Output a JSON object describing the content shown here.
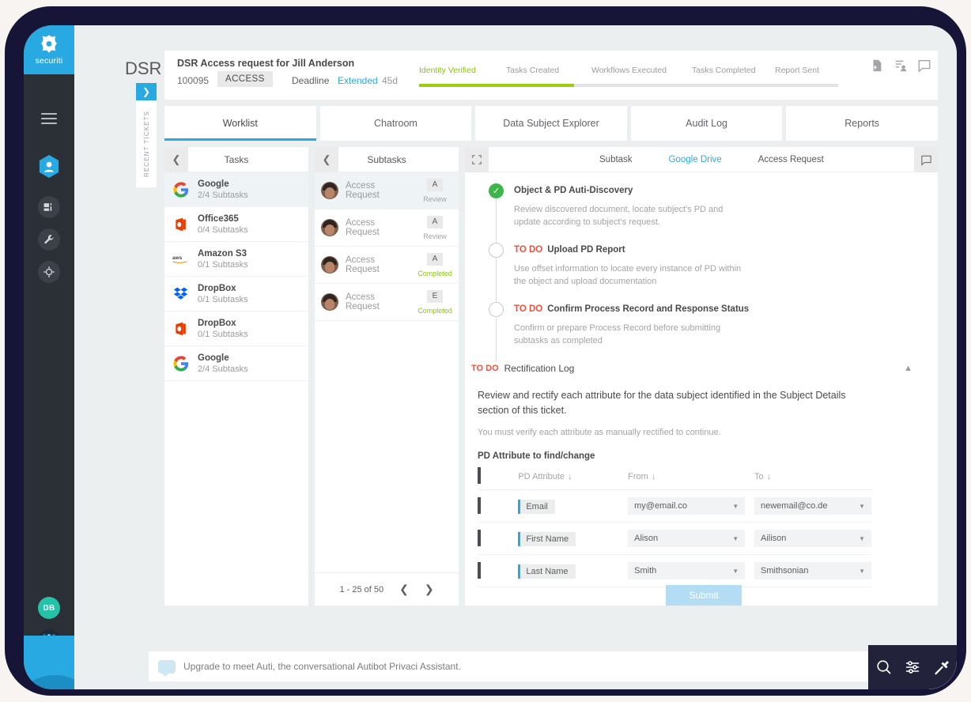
{
  "brand": {
    "name": "securiti",
    "accent": "#29a9e1",
    "logo_icon": "securiti-logo-icon"
  },
  "page": {
    "title": "DSR Workbench"
  },
  "recent_tickets": {
    "label": "RECENT TICKETS",
    "expand_icon": "chevron-right-icon"
  },
  "ticket": {
    "title": "DSR Access request for Jill Anderson",
    "id": "100095",
    "type_badge": "ACCESS",
    "deadline_label": "Deadline",
    "deadline_value": "Extended",
    "deadline_days": "45d",
    "icons": [
      "document-add-icon",
      "assign-user-icon",
      "chat-bubble-icon"
    ]
  },
  "progress": {
    "done_color": "#8cc410",
    "steps": [
      {
        "label": "Identity Verified",
        "done": true
      },
      {
        "label": "Tasks Created",
        "done": false
      },
      {
        "label": "Workflows Executed",
        "done": false
      },
      {
        "label": "Tasks Completed",
        "done": false
      },
      {
        "label": "Report Sent",
        "done": false
      }
    ]
  },
  "tabs": [
    {
      "label": "Worklist",
      "active": true
    },
    {
      "label": "Chatroom",
      "active": false
    },
    {
      "label": "Data Subject Explorer",
      "active": false
    },
    {
      "label": "Audit Log",
      "active": false
    },
    {
      "label": "Reports",
      "active": false
    }
  ],
  "tasks_panel": {
    "header": "Tasks",
    "back_icon": "chevron-left-icon",
    "items": [
      {
        "name": "Google",
        "subtasks": "2/4 Subtasks",
        "logo": "google-logo-icon",
        "selected": true
      },
      {
        "name": "Office365",
        "subtasks": "0/4 Subtasks",
        "logo": "office365-logo-icon",
        "selected": false
      },
      {
        "name": "Amazon S3",
        "subtasks": "0/1 Subtasks",
        "logo": "aws-logo-icon",
        "selected": false
      },
      {
        "name": "DropBox",
        "subtasks": "0/1 Subtasks",
        "logo": "dropbox-logo-icon",
        "selected": false
      },
      {
        "name": "DropBox",
        "subtasks": "0/1 Subtasks",
        "logo": "office365-logo-icon",
        "selected": false
      },
      {
        "name": "Google",
        "subtasks": "2/4 Subtasks",
        "logo": "google-logo-icon",
        "selected": false
      }
    ]
  },
  "subtasks_panel": {
    "header": "Subtasks",
    "back_icon": "chevron-left-icon",
    "items": [
      {
        "name": "Access Request",
        "key": "A",
        "status": "Review",
        "completed": false,
        "selected": true
      },
      {
        "name": "Access Request",
        "key": "A",
        "status": "Review",
        "completed": false,
        "selected": false
      },
      {
        "name": "Access Request",
        "key": "A",
        "status": "Completed",
        "completed": true,
        "selected": false
      },
      {
        "name": "Access Request",
        "key": "E",
        "status": "Completed",
        "completed": true,
        "selected": false
      }
    ],
    "pagination": {
      "range": "1 - 25 of 50",
      "prev_icon": "chevron-left-icon",
      "next_icon": "chevron-right-icon"
    }
  },
  "detail": {
    "expand_icon": "fullscreen-icon",
    "chat_icon": "chat-bubble-icon",
    "breadcrumbs": [
      {
        "label": "Subtask",
        "link": false
      },
      {
        "label": "Google Drive",
        "link": true
      },
      {
        "label": "Access Request",
        "link": false
      }
    ],
    "steps": [
      {
        "state": "done",
        "tag": "",
        "title": "Object & PD Auti-Discovery",
        "desc": "Review discovered document, locate subject's PD and update according to subject's request."
      },
      {
        "state": "todo",
        "tag": "TO DO",
        "title": "Upload PD Report",
        "desc": "Use offset information to locate every instance of PD within the object and upload documentation"
      },
      {
        "state": "todo",
        "tag": "TO DO",
        "title": "Confirm Process Record and Response Status",
        "desc": "Confirm or prepare Process Record before submitting subtasks as completed"
      }
    ],
    "rectification": {
      "tag": "TO DO",
      "title": "Rectification Log",
      "collapse_icon": "chevron-up-icon",
      "paragraph": "Review and rectify each attribute for the data subject identified in the Subject Details section of this ticket.",
      "note": "You must verify each attribute as manually rectified to continue.",
      "table_label": "PD Attribute to find/change",
      "columns": [
        "PD Attribute",
        "From",
        "To"
      ],
      "sort_icon": "arrow-down-icon",
      "rows": [
        {
          "attribute": "Email",
          "from": "my@email.co",
          "to": "newemail@co.de",
          "checked": false
        },
        {
          "attribute": "First Name",
          "from": "Alison",
          "to": "Ailison",
          "checked": false
        },
        {
          "attribute": "Last Name",
          "from": "Smith",
          "to": "Smithsonian",
          "checked": false
        }
      ],
      "submit_label": "Submit"
    }
  },
  "bottom_bar": {
    "chat_placeholder": "Upgrade to meet Auti, the conversational Autibot Privaci Assistant.",
    "chat_icon": "chat-bubble-icon",
    "actions": [
      "search-icon",
      "filter-sliders-icon",
      "tools-hammer-icon"
    ]
  },
  "rail": {
    "menu_icon": "hamburger-menu-icon",
    "items": [
      "privacy-hexagon-icon",
      "dashboard-icon",
      "wrench-icon",
      "settings-gear-icon"
    ],
    "avatar_initials": "DB",
    "apps_icon": "apps-grid-icon"
  }
}
